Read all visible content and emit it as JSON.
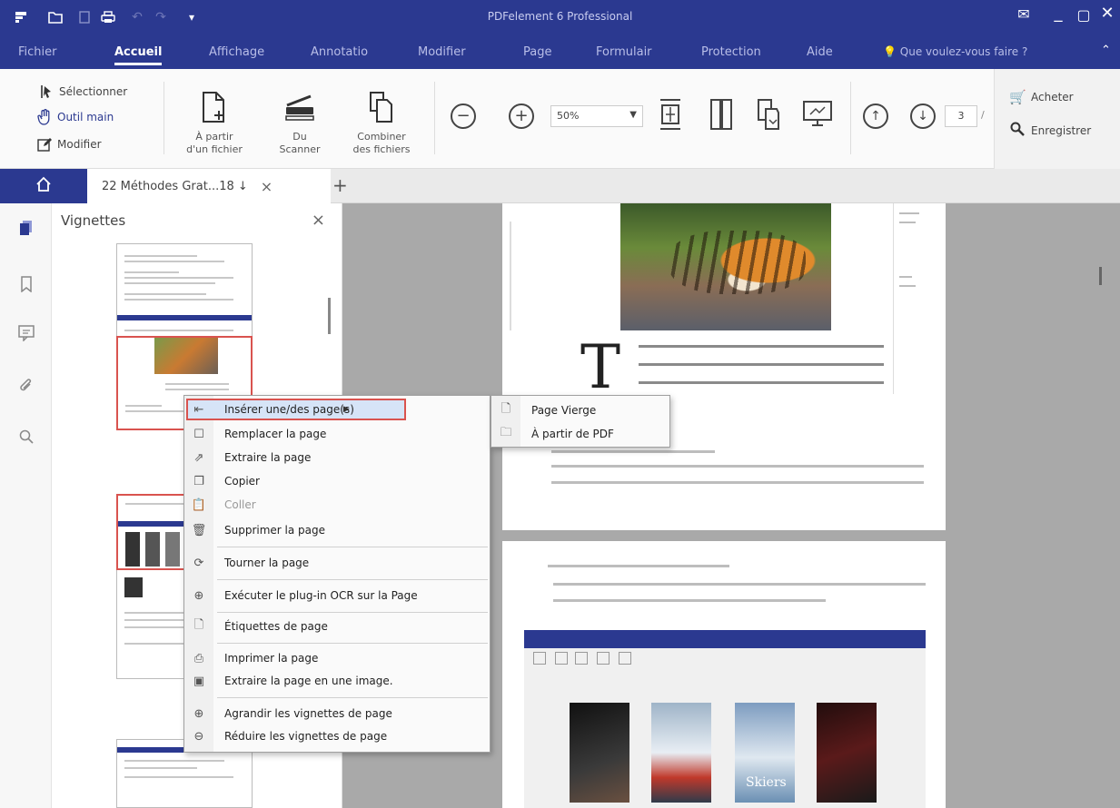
{
  "app": {
    "title": "PDFelement 6 Professional"
  },
  "quick_access_icons": [
    "app-logo-icon",
    "open-folder-icon",
    "save-icon",
    "print-icon",
    "undo-icon",
    "redo-icon",
    "customize-icon"
  ],
  "menu": {
    "items": [
      {
        "label": "Fichier"
      },
      {
        "label": "Accueil",
        "active": true
      },
      {
        "label": "Affichage"
      },
      {
        "label": "Annotatio"
      },
      {
        "label": "Modifier"
      },
      {
        "label": "Page"
      },
      {
        "label": "Formulair"
      },
      {
        "label": "Protection"
      },
      {
        "label": "Aide"
      }
    ],
    "search_label": "Que voulez-vous faire ?"
  },
  "ribbon": {
    "select": "Sélectionner",
    "hand": "Outil main",
    "edit": "Modifier",
    "from_file_line1": "À partir",
    "from_file_line2": "d'un fichier",
    "scanner_line1": "Du",
    "scanner_line2": "Scanner",
    "combine_line1": "Combiner",
    "combine_line2": "des fichiers",
    "zoom_out": "−",
    "zoom_in": "+",
    "zoom_value": "50%",
    "page_current": "3",
    "page_sep": "/",
    "buy": "Acheter",
    "register": "Enregistrer"
  },
  "tabs": {
    "document_tab": "22 Méthodes Grat...18 ↓",
    "close": "×",
    "new": "+"
  },
  "thumbnails_panel": {
    "title": "Vignettes",
    "close": "×"
  },
  "context_menu": {
    "items": [
      {
        "icon": "insert-page-icon",
        "label": "Insérer une/des page(s)",
        "has_submenu": true,
        "highlighted": true
      },
      {
        "icon": "replace-page-icon",
        "label": "Remplacer la page"
      },
      {
        "icon": "extract-page-icon",
        "label": "Extraire la page"
      },
      {
        "icon": "copy-icon",
        "label": "Copier"
      },
      {
        "icon": "paste-icon",
        "label": "Coller",
        "disabled": true
      },
      {
        "icon": "delete-page-icon",
        "label": "Supprimer la page"
      },
      {
        "icon": "rotate-page-icon",
        "label": "Tourner la page"
      },
      {
        "icon": "ocr-icon",
        "label": "Exécuter le plug-in OCR sur la Page"
      },
      {
        "icon": "page-labels-icon",
        "label": "Étiquettes de page"
      },
      {
        "icon": "print-page-icon",
        "label": "Imprimer la page"
      },
      {
        "icon": "export-image-icon",
        "label": "Extraire la page en une image."
      },
      {
        "icon": "zoom-in-thumbs-icon",
        "label": "Agrandir les vignettes de page"
      },
      {
        "icon": "zoom-out-thumbs-icon",
        "label": "Réduire les vignettes de page"
      }
    ],
    "submenu": [
      {
        "icon": "blank-page-icon",
        "label": "Page Vierge"
      },
      {
        "icon": "folder-icon",
        "label": "À partir de PDF"
      }
    ]
  },
  "document": {
    "drop_cap": "T",
    "cover_label": "Skiers"
  },
  "colors": {
    "brand": "#2b3990",
    "highlight_border": "#d9534f",
    "highlight_fill": "#d6e4f7"
  }
}
